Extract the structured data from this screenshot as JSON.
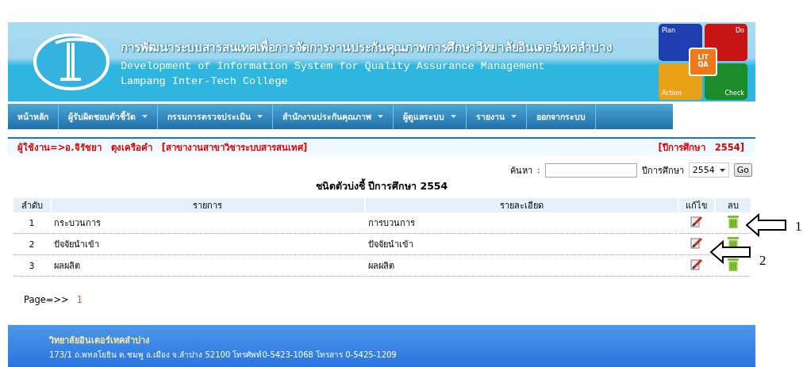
{
  "header": {
    "title_th": "การพัฒนาระบบสารสนเทศเพื่อการจัดการงานประกันคุณภาพการศึกษาวิทยาลัยอินเตอร์เทคลำปาง",
    "title_en": "Development of Information System for Quality Assurance Management",
    "subtitle": "Lampang Inter-Tech College",
    "logo": {
      "quadrants": [
        {
          "label": "Plan",
          "color": "#1f3fb0"
        },
        {
          "label": "Do",
          "color": "#c81414"
        },
        {
          "label": "Action",
          "color": "#e8a21a"
        },
        {
          "label": "Check",
          "color": "#1d8a2a"
        }
      ],
      "center_top": "LIT",
      "center_bottom": "QA"
    }
  },
  "nav": [
    {
      "label": "หน้าหลัก",
      "dropdown": false
    },
    {
      "label": "ผู้รับผิดชอบตัวชี้วัด",
      "dropdown": true
    },
    {
      "label": "กรรมการตรวจประเมิน",
      "dropdown": true
    },
    {
      "label": "สำนักงานประกันคุณภาพ",
      "dropdown": true
    },
    {
      "label": "ผู้ดูแลระบบ",
      "dropdown": true
    },
    {
      "label": "รายงาน",
      "dropdown": true
    },
    {
      "label": "ออกจากระบบ",
      "dropdown": false
    }
  ],
  "user_line": {
    "user": "ผู้ใช้งาน=>อ.จิรัชยา   ตุงเครือคำ   [สาขางานสาขาวิชาระบบสารสนเทศ]",
    "year": "[ปีการศึกษา   2554]"
  },
  "search": {
    "label": "ค้นหา",
    "separator": ":",
    "year_label": "ปีการศึกษา",
    "year_value": "2554",
    "button": "Go"
  },
  "table": {
    "title": "ชนิดตัวบ่งชี้ ปีการศึกษา 2554",
    "columns": [
      "ลำดับ",
      "รายการ",
      "รายละเอียด",
      "แก้ไข",
      "ลบ"
    ],
    "rows": [
      {
        "index": "1",
        "item": "กระบวนการ",
        "detail": "การบวนการ",
        "callout": {
          "label": "1",
          "kind": "delete"
        }
      },
      {
        "index": "2",
        "item": "ปัจจัยนำเข้า",
        "detail": "ปัจจัยนำเข้า",
        "callout": {
          "label": "2",
          "kind": "edit"
        }
      },
      {
        "index": "3",
        "item": "ผลผลิต",
        "detail": "ผลผลิต"
      }
    ]
  },
  "pager": {
    "label": "Page=>>",
    "pages": [
      {
        "label": "1",
        "selected": true
      }
    ]
  },
  "footer": {
    "name": "วิทยาลัยอินเตอร์เทคลำปาง",
    "address": "173/1 ถ.พหลโยธิน ต.ชมพู อ.เมือง จ.ลำปาง 52100 โทรศัพท์0-5423-1068 โทรสาร 0-5425-1209"
  }
}
